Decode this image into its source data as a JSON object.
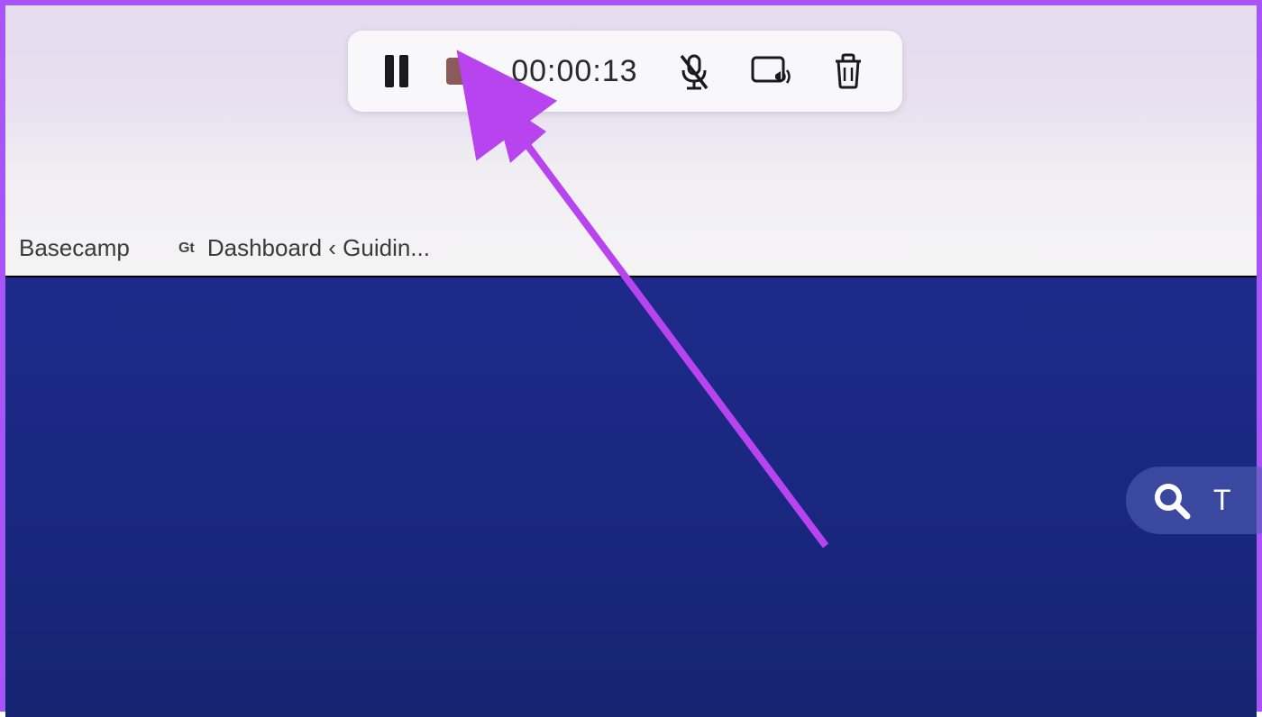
{
  "recording_toolbar": {
    "timer": "00:00:13"
  },
  "bookmarks": {
    "items": [
      {
        "label": "Basecamp"
      },
      {
        "favicon_text": "Gt",
        "label": "Dashboard ‹ Guidin..."
      }
    ]
  },
  "search": {
    "partial_text": "T"
  },
  "colors": {
    "border": "#a855f7",
    "arrow": "#b844f0",
    "content_bg": "#1a2780",
    "stop_button": "#8b5a5a"
  }
}
